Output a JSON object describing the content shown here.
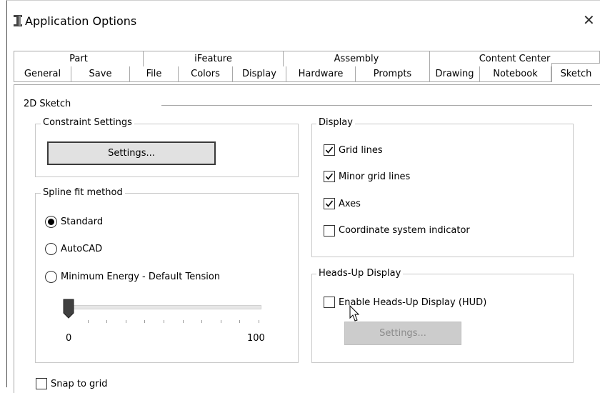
{
  "window": {
    "title": "Application Options",
    "icon": "inventor-i-icon",
    "close_glyph": "✕"
  },
  "tabs": {
    "row_top": [
      "Part",
      "iFeature",
      "Assembly",
      "Content Center"
    ],
    "row_bottom": [
      "General",
      "Save",
      "File",
      "Colors",
      "Display",
      "Hardware",
      "Prompts",
      "Drawing",
      "Notebook",
      "Sketch"
    ],
    "selected": "Sketch"
  },
  "section": {
    "label": "2D Sketch"
  },
  "constraint_settings": {
    "legend": "Constraint Settings",
    "button_label": "Settings..."
  },
  "spline_fit": {
    "legend": "Spline fit method",
    "options": [
      {
        "label": "Standard",
        "selected": true
      },
      {
        "label": "AutoCAD",
        "selected": false
      },
      {
        "label": "Minimum Energy - Default Tension",
        "selected": false
      }
    ],
    "slider": {
      "min_label": "0",
      "max_label": "100",
      "value": 0
    }
  },
  "display": {
    "legend": "Display",
    "checks": [
      {
        "label": "Grid lines",
        "checked": true
      },
      {
        "label": "Minor grid lines",
        "checked": true
      },
      {
        "label": "Axes",
        "checked": true
      },
      {
        "label": "Coordinate system indicator",
        "checked": false
      }
    ]
  },
  "hud": {
    "legend": "Heads-Up Display",
    "enable_label": "Enable Heads-Up Display (HUD)",
    "enabled": false,
    "settings_label": "Settings..."
  },
  "snap": {
    "label": "Snap to grid",
    "checked": false
  }
}
